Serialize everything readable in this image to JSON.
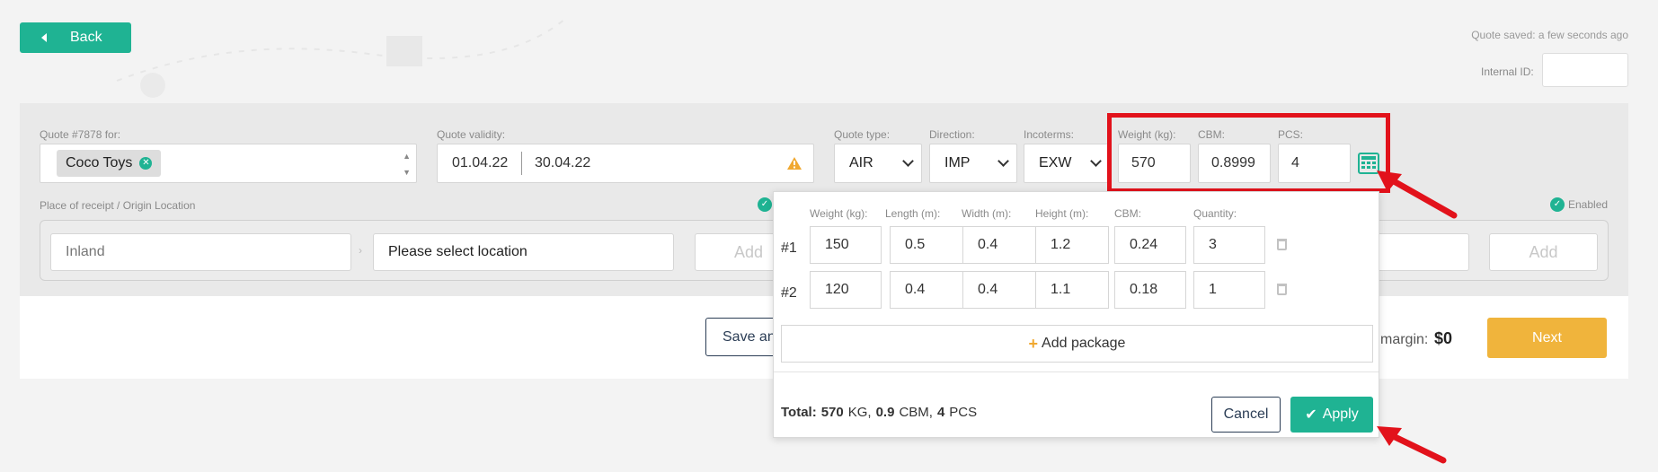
{
  "header": {
    "back_label": "Back",
    "saved_status": "Quote saved: a few seconds ago",
    "internal_id_label": "Internal ID:",
    "internal_id_value": ""
  },
  "quote": {
    "for_label": "Quote #7878 for:",
    "customer_chip": "Coco Toys",
    "validity_label": "Quote validity:",
    "validity_from": "01.04.22",
    "validity_to": "30.04.22",
    "type_label": "Quote type:",
    "type_value": "AIR",
    "direction_label": "Direction:",
    "direction_value": "IMP",
    "incoterms_label": "Incoterms:",
    "incoterms_value": "EXW",
    "weight_label": "Weight (kg):",
    "weight_value": "570",
    "cbm_label": "CBM:",
    "cbm_value": "0.8999",
    "pcs_label": "PCS:",
    "pcs_value": "4"
  },
  "route": {
    "origin_label": "Place of receipt / Origin Location",
    "inland_placeholder": "Inland",
    "location_value": "Please select location",
    "add_label": "Add",
    "add_label_right": "Add",
    "enabled_label": "Enabled"
  },
  "footer": {
    "save_label": "Save an",
    "margin_label": "margin:",
    "margin_value": "$0",
    "next_label": "Next"
  },
  "calculator": {
    "col_weight": "Weight (kg):",
    "col_length": "Length (m):",
    "col_width": "Width (m):",
    "col_height": "Height (m):",
    "col_cbm": "CBM:",
    "col_quantity": "Quantity:",
    "rows": [
      {
        "index": "#1",
        "weight": "150",
        "length": "0.5",
        "width": "0.4",
        "height": "1.2",
        "cbm": "0.24",
        "quantity": "3"
      },
      {
        "index": "#2",
        "weight": "120",
        "length": "0.4",
        "width": "0.4",
        "height": "1.1",
        "cbm": "0.18",
        "quantity": "1"
      }
    ],
    "add_package_label": "Add package",
    "total_prefix": "Total:",
    "total_kg": "570",
    "total_kg_unit": "KG,",
    "total_cbm": "0.9",
    "total_cbm_unit": "CBM,",
    "total_pcs": "4",
    "total_pcs_unit": "PCS",
    "cancel_label": "Cancel",
    "apply_label": "Apply"
  },
  "colors": {
    "accent_green": "#1fb393",
    "next_orange": "#f0b43c",
    "highlight_red": "#e2121b",
    "warning_orange": "#f0a830"
  }
}
